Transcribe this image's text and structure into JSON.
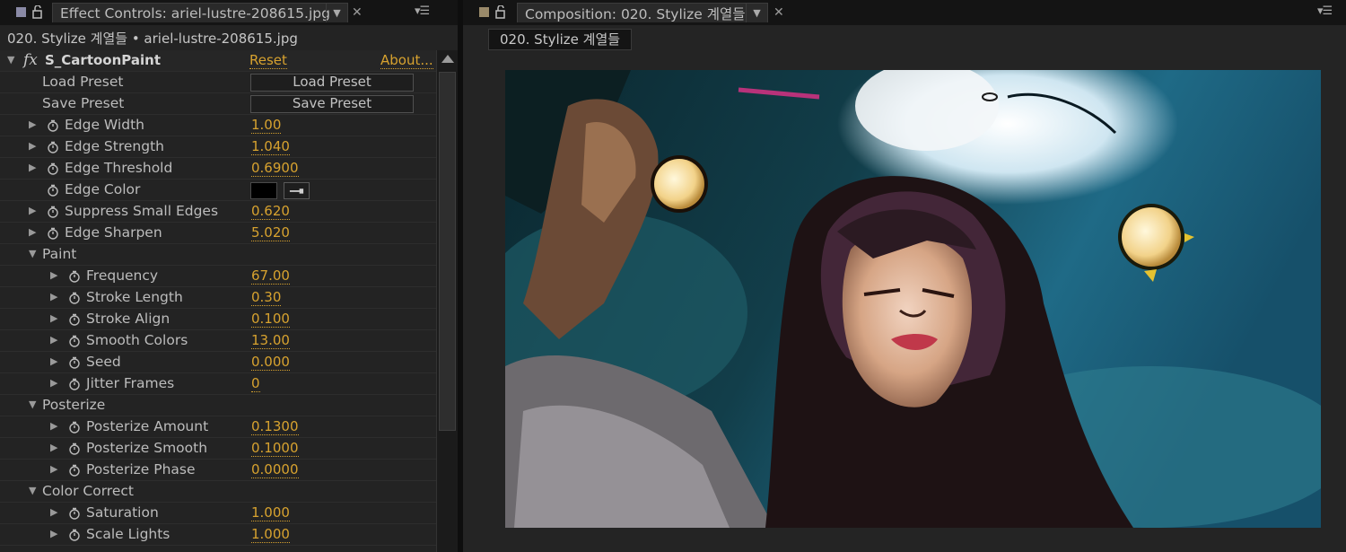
{
  "left_panel": {
    "tab_title": "Effect Controls: ariel-lustre-208615.jpg",
    "subtitle": "020. Stylize 계열들 • ariel-lustre-208615.jpg",
    "effect": {
      "name": "S_CartoonPaint",
      "reset_label": "Reset",
      "about_label": "About...",
      "load_preset": {
        "label": "Load Preset",
        "button": "Load Preset"
      },
      "save_preset": {
        "label": "Save Preset",
        "button": "Save Preset"
      },
      "edge_params": [
        {
          "label": "Edge Width",
          "value": "1.00"
        },
        {
          "label": "Edge Strength",
          "value": "1.040"
        },
        {
          "label": "Edge Threshold",
          "value": "0.6900"
        },
        {
          "label": "Edge Color",
          "value": "#000000"
        },
        {
          "label": "Suppress Small Edges",
          "value": "0.620"
        },
        {
          "label": "Edge Sharpen",
          "value": "5.020"
        }
      ],
      "paint": {
        "label": "Paint",
        "params": [
          {
            "label": "Frequency",
            "value": "67.00"
          },
          {
            "label": "Stroke Length",
            "value": "0.30"
          },
          {
            "label": "Stroke Align",
            "value": "0.100"
          },
          {
            "label": "Smooth Colors",
            "value": "13.00"
          },
          {
            "label": "Seed",
            "value": "0.000"
          },
          {
            "label": "Jitter Frames",
            "value": "0"
          }
        ]
      },
      "posterize": {
        "label": "Posterize",
        "params": [
          {
            "label": "Posterize Amount",
            "value": "0.1300"
          },
          {
            "label": "Posterize Smooth",
            "value": "0.1000"
          },
          {
            "label": "Posterize Phase",
            "value": "0.0000"
          }
        ]
      },
      "color_correct": {
        "label": "Color Correct",
        "params": [
          {
            "label": "Saturation",
            "value": "1.000"
          },
          {
            "label": "Scale Lights",
            "value": "1.000"
          }
        ]
      }
    }
  },
  "right_panel": {
    "tab_title": "Composition: 020. Stylize 계열들",
    "comp_chip": "020. Stylize 계열들"
  },
  "colors": {
    "accent_value": "#d7a22f",
    "panel_bg": "#232323",
    "tab_bg": "#141414"
  }
}
